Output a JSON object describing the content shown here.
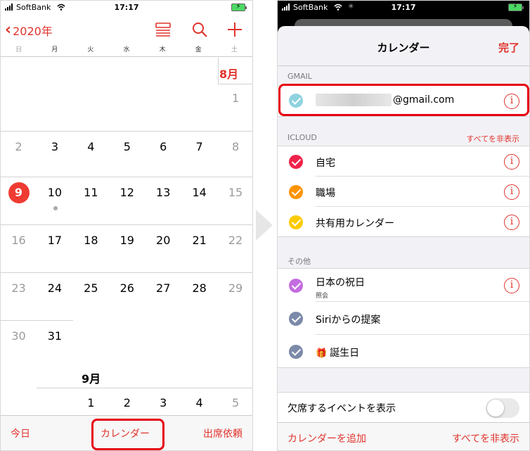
{
  "colors": {
    "accent": "#e0332c",
    "today_circle": "#ef3b32",
    "highlight_box": "#e60012"
  },
  "left": {
    "status": {
      "carrier": "SoftBank",
      "time": "17:17"
    },
    "nav": {
      "back_label": "2020年"
    },
    "weekdays": [
      "日",
      "月",
      "火",
      "水",
      "木",
      "金",
      "土"
    ],
    "month_aug": "8月",
    "month_sep": "9月",
    "aug_rows": [
      [
        "",
        "",
        "",
        "",
        "",
        "",
        "1"
      ],
      [
        "2",
        "3",
        "4",
        "5",
        "6",
        "7",
        "8"
      ],
      [
        "9",
        "10",
        "11",
        "12",
        "13",
        "14",
        "15"
      ],
      [
        "16",
        "17",
        "18",
        "19",
        "20",
        "21",
        "22"
      ],
      [
        "23",
        "24",
        "25",
        "26",
        "27",
        "28",
        "29"
      ],
      [
        "30",
        "31",
        "",
        "",
        "",
        "",
        ""
      ]
    ],
    "today": "9",
    "sep_row": [
      "",
      "1",
      "2",
      "3",
      "4",
      "5"
    ],
    "toolbar": {
      "today": "今日",
      "calendars": "カレンダー",
      "inbox": "出席依頼"
    }
  },
  "right": {
    "status": {
      "carrier": "SoftBank",
      "time": "17:17"
    },
    "title": "カレンダー",
    "done": "完了",
    "gmail": {
      "header": "GMAIL",
      "account_suffix": "@gmail.com",
      "check_color": "#8fd3e0"
    },
    "icloud": {
      "header": "ICLOUD",
      "hide_all": "すべてを非表示",
      "items": [
        {
          "label": "自宅",
          "color": "#f0224b"
        },
        {
          "label": "職場",
          "color": "#fd9400"
        },
        {
          "label": "共有用カレンダー",
          "color": "#fccb00"
        }
      ]
    },
    "other": {
      "header": "その他",
      "items": [
        {
          "label": "日本の祝日",
          "sub": "照会",
          "color": "#c36de0"
        },
        {
          "label": "Siriからの提案",
          "color": "#7b8aa8"
        },
        {
          "label": "誕生日",
          "color": "#7b8aa8"
        }
      ]
    },
    "declined_label": "欠席するイベントを表示",
    "footer": {
      "add": "カレンダーを追加",
      "hide_all": "すべてを非表示"
    }
  }
}
